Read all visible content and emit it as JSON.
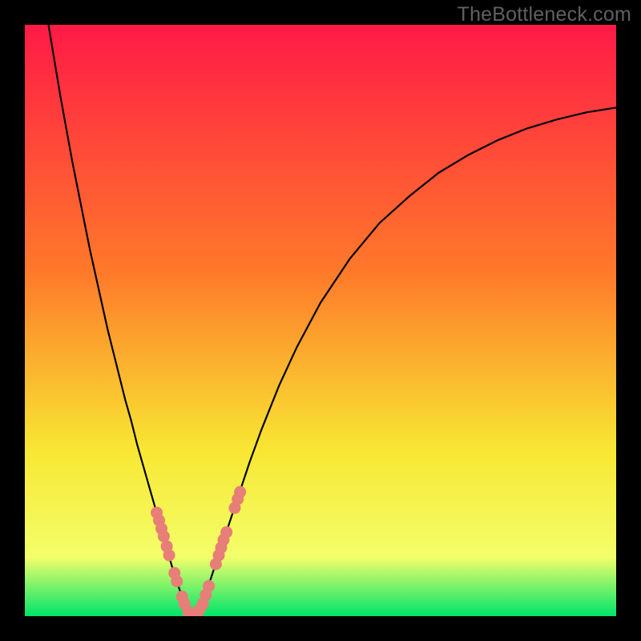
{
  "watermark": "TheBottleneck.com",
  "colors": {
    "background": "#000000",
    "curve": "#000000",
    "dots": "#e77e77",
    "gradient": {
      "top": "#ff1a46",
      "mid1": "#ff7a2a",
      "mid2": "#f8e733",
      "mid3": "#f3ff6a",
      "bottom": "#00e46a"
    }
  },
  "chart_data": {
    "type": "line",
    "title": "",
    "xlabel": "",
    "ylabel": "",
    "x_range": [
      0,
      100
    ],
    "y_range": [
      0,
      100
    ],
    "curve": [
      {
        "x": 4.0,
        "y": 100.0
      },
      {
        "x": 5.0,
        "y": 94.0
      },
      {
        "x": 6.0,
        "y": 88.0
      },
      {
        "x": 7.0,
        "y": 82.5
      },
      {
        "x": 8.0,
        "y": 77.0
      },
      {
        "x": 9.0,
        "y": 72.0
      },
      {
        "x": 10.0,
        "y": 67.0
      },
      {
        "x": 11.0,
        "y": 62.0
      },
      {
        "x": 12.0,
        "y": 57.5
      },
      {
        "x": 13.0,
        "y": 53.0
      },
      {
        "x": 14.0,
        "y": 48.5
      },
      {
        "x": 15.0,
        "y": 44.5
      },
      {
        "x": 16.0,
        "y": 40.5
      },
      {
        "x": 17.0,
        "y": 36.5
      },
      {
        "x": 18.0,
        "y": 33.0
      },
      {
        "x": 19.0,
        "y": 29.0
      },
      {
        "x": 20.0,
        "y": 25.5
      },
      {
        "x": 21.0,
        "y": 22.0
      },
      {
        "x": 22.0,
        "y": 18.5
      },
      {
        "x": 23.0,
        "y": 15.0
      },
      {
        "x": 24.0,
        "y": 11.5
      },
      {
        "x": 25.0,
        "y": 8.0
      },
      {
        "x": 26.0,
        "y": 5.0
      },
      {
        "x": 27.0,
        "y": 2.0
      },
      {
        "x": 28.0,
        "y": 0.5
      },
      {
        "x": 29.0,
        "y": 0.5
      },
      {
        "x": 30.0,
        "y": 2.0
      },
      {
        "x": 31.0,
        "y": 5.0
      },
      {
        "x": 32.0,
        "y": 8.0
      },
      {
        "x": 33.0,
        "y": 11.0
      },
      {
        "x": 34.0,
        "y": 14.0
      },
      {
        "x": 35.0,
        "y": 17.0
      },
      {
        "x": 36.0,
        "y": 20.0
      },
      {
        "x": 38.0,
        "y": 26.0
      },
      {
        "x": 40.0,
        "y": 31.5
      },
      {
        "x": 43.0,
        "y": 39.0
      },
      {
        "x": 46.0,
        "y": 45.5
      },
      {
        "x": 50.0,
        "y": 53.0
      },
      {
        "x": 55.0,
        "y": 60.5
      },
      {
        "x": 60.0,
        "y": 66.5
      },
      {
        "x": 65.0,
        "y": 71.0
      },
      {
        "x": 70.0,
        "y": 75.0
      },
      {
        "x": 75.0,
        "y": 78.0
      },
      {
        "x": 80.0,
        "y": 80.5
      },
      {
        "x": 85.0,
        "y": 82.5
      },
      {
        "x": 90.0,
        "y": 84.0
      },
      {
        "x": 95.0,
        "y": 85.2
      },
      {
        "x": 100.0,
        "y": 86.0
      }
    ],
    "dots_left": [
      {
        "x": 22.3,
        "y": 17.5
      },
      {
        "x": 22.7,
        "y": 16.2
      },
      {
        "x": 23.1,
        "y": 14.8
      },
      {
        "x": 23.5,
        "y": 13.5
      },
      {
        "x": 24.0,
        "y": 11.8
      },
      {
        "x": 24.4,
        "y": 10.3
      },
      {
        "x": 25.3,
        "y": 7.3
      },
      {
        "x": 25.7,
        "y": 5.9
      },
      {
        "x": 26.6,
        "y": 3.3
      },
      {
        "x": 27.0,
        "y": 2.1
      }
    ],
    "dots_right": [
      {
        "x": 29.6,
        "y": 1.2
      },
      {
        "x": 30.1,
        "y": 2.1
      },
      {
        "x": 30.6,
        "y": 3.6
      },
      {
        "x": 31.1,
        "y": 5.1
      },
      {
        "x": 32.3,
        "y": 8.8
      },
      {
        "x": 32.8,
        "y": 10.3
      },
      {
        "x": 33.2,
        "y": 11.6
      },
      {
        "x": 33.6,
        "y": 12.9
      },
      {
        "x": 34.1,
        "y": 14.2
      },
      {
        "x": 35.5,
        "y": 18.3
      },
      {
        "x": 36.0,
        "y": 19.8
      },
      {
        "x": 36.4,
        "y": 21.0
      }
    ],
    "dots_bottom": [
      {
        "x": 27.6,
        "y": 0.7
      },
      {
        "x": 28.2,
        "y": 0.5
      },
      {
        "x": 28.8,
        "y": 0.5
      },
      {
        "x": 29.2,
        "y": 0.6
      }
    ]
  }
}
